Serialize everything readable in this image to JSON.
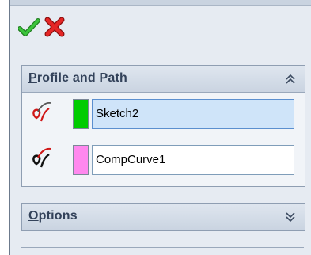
{
  "toolbar": {
    "ok_icon": "check-icon",
    "cancel_icon": "x-icon",
    "ok_color": "#2fa32f",
    "cancel_color": "#d61f1f"
  },
  "profile_section": {
    "title_first": "P",
    "title_rest": "rofile and Path",
    "collapse_icon": "double-chevron-up-icon",
    "profile": {
      "icon": "profile-selection-icon",
      "swatch_color": "#00cc00",
      "value": "Sketch2",
      "active": true
    },
    "path": {
      "icon": "path-selection-icon",
      "swatch_color": "#ff88ee",
      "value": "CompCurve1",
      "active": false
    }
  },
  "options_section": {
    "title_first": "O",
    "title_rest": "ptions",
    "expand_icon": "double-chevron-down-icon"
  }
}
